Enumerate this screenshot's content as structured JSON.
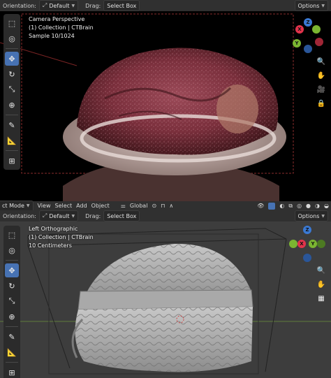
{
  "top_header": {
    "orientation_label": "Orientation:",
    "orientation_value": "Default",
    "drag_label": "Drag:",
    "drag_value": "Select Box",
    "options_label": "Options"
  },
  "top_viewport": {
    "info_lines": [
      "Camera Perspective",
      "(1) Collection | CTBrain",
      "Sample 10/1024"
    ]
  },
  "mid_header": {
    "mode_label": "ct Mode",
    "menus": [
      "View",
      "Select",
      "Add",
      "Object"
    ],
    "transform_value": "Global"
  },
  "bottom_header": {
    "orientation_label": "Orientation:",
    "orientation_value": "Default",
    "drag_label": "Drag:",
    "drag_value": "Select Box",
    "options_label": "Options"
  },
  "bottom_viewport": {
    "info_lines": [
      "Left Orthographic",
      "(1) Collection | CTBrain",
      "10 Centimeters"
    ]
  },
  "gizmo_axes": {
    "x": "X",
    "y": "Y",
    "z": "Z"
  },
  "colors": {
    "accent": "#4772b3",
    "axis_x": "#e2334b",
    "axis_y": "#7bb531",
    "axis_z": "#3a79d3"
  },
  "icons": {
    "toolbar": [
      "select-box-icon",
      "cursor-icon",
      "move-icon",
      "rotate-icon",
      "scale-icon",
      "transform-icon",
      "annotate-icon",
      "measure-icon",
      "add-cube-icon"
    ],
    "nav_top": [
      "zoom-icon",
      "hand-icon",
      "camera-icon",
      "lock-icon"
    ],
    "nav_bottom": [
      "zoom-icon",
      "hand-icon",
      "grid-icon"
    ]
  }
}
